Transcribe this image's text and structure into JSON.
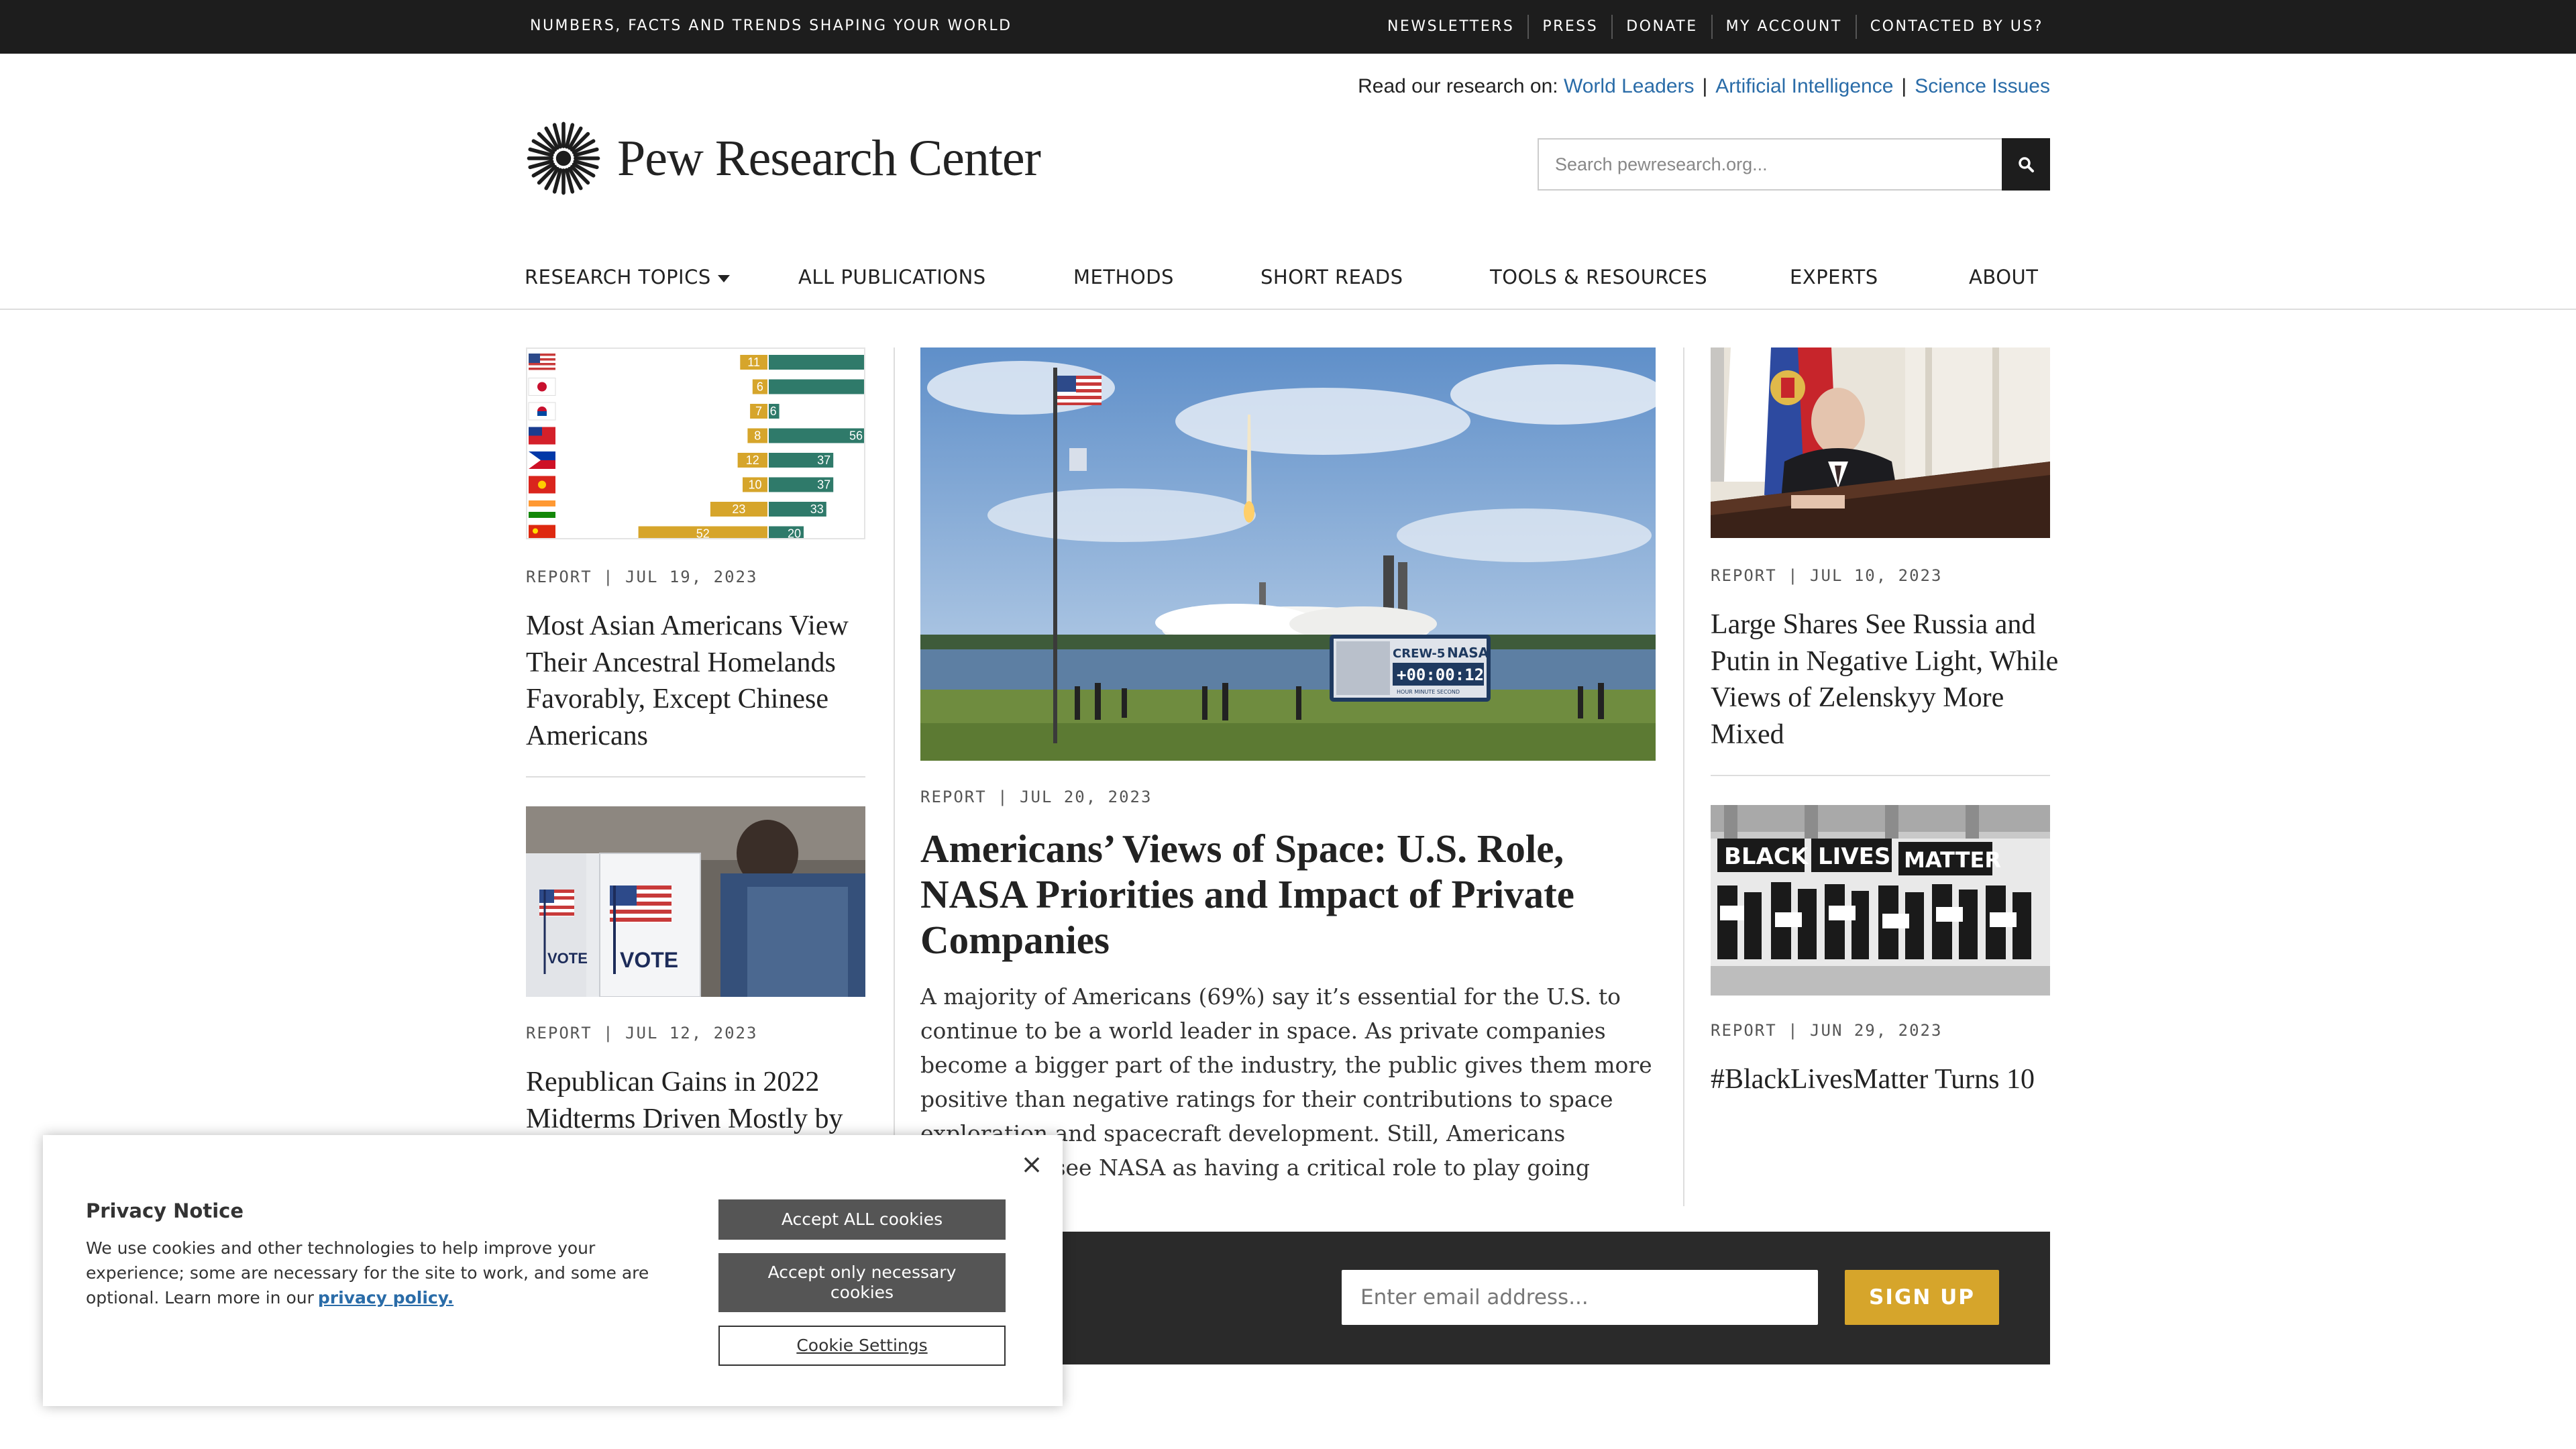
{
  "topbar": {
    "tagline": "NUMBERS, FACTS AND TRENDS SHAPING YOUR WORLD",
    "links": [
      "NEWSLETTERS",
      "PRESS",
      "DONATE",
      "MY ACCOUNT",
      "CONTACTED BY US?"
    ]
  },
  "header": {
    "research_prefix": "Read our research on:",
    "research_links": [
      "World Leaders",
      "Artificial Intelligence",
      "Science Issues"
    ],
    "logo_text": "Pew Research Center",
    "search_placeholder": "Search pewresearch.org..."
  },
  "nav": {
    "items": [
      "RESEARCH TOPICS",
      "ALL PUBLICATIONS",
      "METHODS",
      "SHORT READS",
      "TOOLS & RESOURCES",
      "EXPERTS",
      "ABOUT"
    ]
  },
  "left": {
    "card1": {
      "meta": "REPORT | JUL 19, 2023",
      "title": "Most Asian Americans View Their Ancestral Homelands Favorably, Except Chinese Americans",
      "chart": {
        "rows": [
          {
            "flag": "us",
            "a": 11,
            "b": null
          },
          {
            "flag": "jp",
            "a": 6,
            "b": null
          },
          {
            "flag": "kr",
            "a": 7,
            "b": 6
          },
          {
            "flag": "tw",
            "a": 8,
            "b": 56
          },
          {
            "flag": "ph",
            "a": 12,
            "b": 37
          },
          {
            "flag": "vn",
            "a": 10,
            "b": 37
          },
          {
            "flag": "in",
            "a": 23,
            "b": 33
          },
          {
            "flag": "cn",
            "a": 52,
            "b": 20
          }
        ]
      }
    },
    "card2": {
      "meta": "REPORT | JUL 12, 2023",
      "title": "Republican Gains in 2022 Midterms Driven Mostly by",
      "photo_text": [
        "VOTE",
        "VOTE"
      ]
    }
  },
  "center": {
    "meta": "REPORT | JUL 20, 2023",
    "title": "Americans’ Views of Space: U.S. Role, NASA Priorities and Impact of Private Companies",
    "excerpt": "A majority of Americans (69%) say it’s essential for the U.S. to continue to be a world leader in space. As private companies become a bigger part of the industry, the public gives them more positive than negative ratings for their contributions to space exploration and spacecraft development. Still, Americans continue to see NASA as having a critical role to play going forward.",
    "photo_text": {
      "sign_label": "CREW-5",
      "sign_brand": "NASA",
      "clock": "+00:00:12",
      "clock_units": "HOUR   MINUTE   SECOND"
    }
  },
  "right": {
    "card1": {
      "meta": "REPORT | JUL 10, 2023",
      "title": "Large Shares See Russia and Putin in Negative Light, While Views of Zelenskyy More Mixed"
    },
    "card2": {
      "meta": "REPORT | JUN 29, 2023",
      "title": "#BlackLivesMatter Turns 10",
      "photo_text": [
        "BLACK",
        "LIVES",
        "MATTER"
      ]
    }
  },
  "newsletter": {
    "placeholder": "Enter email address...",
    "button": "SIGN UP"
  },
  "privacy": {
    "title": "Privacy Notice",
    "body": "We use cookies and other technologies to help improve your experience; some are necessary for the site to work, and some are optional. Learn more in our",
    "link": "privacy policy.",
    "accept_all": "Accept ALL cookies",
    "accept_necessary": "Accept only necessary cookies",
    "settings": "Cookie Settings",
    "close_symbol": "×"
  },
  "colors": {
    "topbar": "#1d1d1d",
    "link": "#2a6ca8",
    "gold": "#d6a52b",
    "teal": "#2f7a6a",
    "newsletter_bg": "#2a2a2a"
  }
}
